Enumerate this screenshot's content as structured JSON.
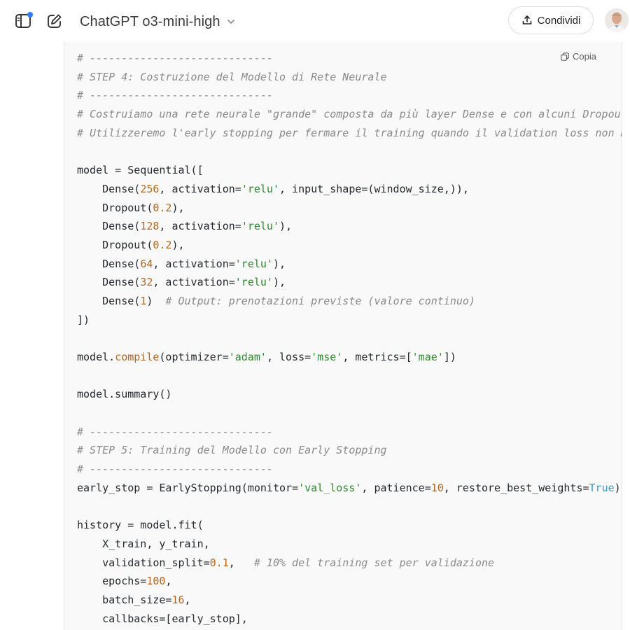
{
  "header": {
    "model_name": "ChatGPT o3-mini-high",
    "share_label": "Condividi"
  },
  "code_block": {
    "copy_label": "Copia",
    "lines": [
      [
        {
          "t": "cm",
          "v": "# -----------------------------"
        }
      ],
      [
        {
          "t": "cm",
          "v": "# STEP 4: Costruzione del Modello di Rete Neurale"
        }
      ],
      [
        {
          "t": "cm",
          "v": "# -----------------------------"
        }
      ],
      [
        {
          "t": "cm",
          "v": "# Costruiamo una rete neurale \"grande\" composta da più layer Dense e con alcuni Dropout per"
        }
      ],
      [
        {
          "t": "cm",
          "v": "# Utilizzeremo l'early stopping per fermare il training quando il validation loss non migli"
        }
      ],
      [],
      [
        {
          "t": "",
          "v": "model = Sequential(["
        }
      ],
      [
        {
          "t": "",
          "v": "    Dense("
        },
        {
          "t": "nm",
          "v": "256"
        },
        {
          "t": "",
          "v": ", activation="
        },
        {
          "t": "st",
          "v": "'relu'"
        },
        {
          "t": "",
          "v": ", input_shape=(window_size,)),"
        }
      ],
      [
        {
          "t": "",
          "v": "    Dropout("
        },
        {
          "t": "nm",
          "v": "0.2"
        },
        {
          "t": "",
          "v": "),"
        }
      ],
      [
        {
          "t": "",
          "v": "    Dense("
        },
        {
          "t": "nm",
          "v": "128"
        },
        {
          "t": "",
          "v": ", activation="
        },
        {
          "t": "st",
          "v": "'relu'"
        },
        {
          "t": "",
          "v": "),"
        }
      ],
      [
        {
          "t": "",
          "v": "    Dropout("
        },
        {
          "t": "nm",
          "v": "0.2"
        },
        {
          "t": "",
          "v": "),"
        }
      ],
      [
        {
          "t": "",
          "v": "    Dense("
        },
        {
          "t": "nm",
          "v": "64"
        },
        {
          "t": "",
          "v": ", activation="
        },
        {
          "t": "st",
          "v": "'relu'"
        },
        {
          "t": "",
          "v": "),"
        }
      ],
      [
        {
          "t": "",
          "v": "    Dense("
        },
        {
          "t": "nm",
          "v": "32"
        },
        {
          "t": "",
          "v": ", activation="
        },
        {
          "t": "st",
          "v": "'relu'"
        },
        {
          "t": "",
          "v": "),"
        }
      ],
      [
        {
          "t": "",
          "v": "    Dense("
        },
        {
          "t": "nm",
          "v": "1"
        },
        {
          "t": "",
          "v": ")  "
        },
        {
          "t": "cm",
          "v": "# Output: prenotazioni previste (valore continuo)"
        }
      ],
      [
        {
          "t": "",
          "v": "])"
        }
      ],
      [],
      [
        {
          "t": "",
          "v": "model."
        },
        {
          "t": "fn",
          "v": "compile"
        },
        {
          "t": "",
          "v": "(optimizer="
        },
        {
          "t": "st",
          "v": "'adam'"
        },
        {
          "t": "",
          "v": ", loss="
        },
        {
          "t": "st",
          "v": "'mse'"
        },
        {
          "t": "",
          "v": ", metrics=["
        },
        {
          "t": "st",
          "v": "'mae'"
        },
        {
          "t": "",
          "v": "])"
        }
      ],
      [],
      [
        {
          "t": "",
          "v": "model.summary()"
        }
      ],
      [],
      [
        {
          "t": "cm",
          "v": "# -----------------------------"
        }
      ],
      [
        {
          "t": "cm",
          "v": "# STEP 5: Training del Modello con Early Stopping"
        }
      ],
      [
        {
          "t": "cm",
          "v": "# -----------------------------"
        }
      ],
      [
        {
          "t": "",
          "v": "early_stop = EarlyStopping(monitor="
        },
        {
          "t": "st",
          "v": "'val_loss'"
        },
        {
          "t": "",
          "v": ", patience="
        },
        {
          "t": "nm",
          "v": "10"
        },
        {
          "t": "",
          "v": ", restore_best_weights="
        },
        {
          "t": "kw",
          "v": "True"
        },
        {
          "t": "",
          "v": ")"
        }
      ],
      [],
      [
        {
          "t": "",
          "v": "history = model.fit("
        }
      ],
      [
        {
          "t": "",
          "v": "    X_train, y_train,"
        }
      ],
      [
        {
          "t": "",
          "v": "    validation_split="
        },
        {
          "t": "nm",
          "v": "0.1"
        },
        {
          "t": "",
          "v": ",   "
        },
        {
          "t": "cm",
          "v": "# 10% del training set per validazione"
        }
      ],
      [
        {
          "t": "",
          "v": "    epochs="
        },
        {
          "t": "nm",
          "v": "100"
        },
        {
          "t": "",
          "v": ","
        }
      ],
      [
        {
          "t": "",
          "v": "    batch_size="
        },
        {
          "t": "nm",
          "v": "16"
        },
        {
          "t": "",
          "v": ","
        }
      ],
      [
        {
          "t": "",
          "v": "    callbacks=[early_stop],"
        }
      ]
    ]
  },
  "colors": {
    "comment": "#8a8a8a",
    "string": "#2e8a2e",
    "number": "#b5651d",
    "keyword": "#3b9bc9",
    "notification_dot": "#2f7bff"
  },
  "icons": [
    "sidebar-toggle-icon",
    "new-chat-icon",
    "chevron-down-icon",
    "share-upload-icon",
    "copy-icon"
  ]
}
